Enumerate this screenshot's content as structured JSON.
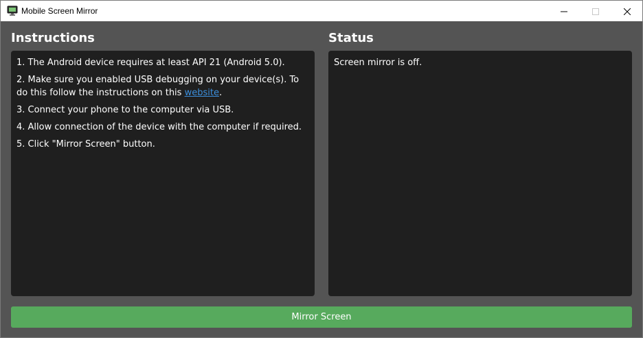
{
  "window": {
    "title": "Mobile Screen Mirror",
    "icon": "monitor-icon",
    "controls": {
      "minimize": "minimize-icon",
      "maximize": "maximize-icon",
      "close": "close-icon"
    }
  },
  "instructions": {
    "heading": "Instructions",
    "items": [
      {
        "text": "1. The Android device requires at least API 21 (Android 5.0)."
      },
      {
        "text_before": "2. Make sure you enabled USB debugging on your device(s). To do this follow the instructions on this ",
        "link_text": "website",
        "text_after": "."
      },
      {
        "text": "3. Connect your phone to the computer via USB."
      },
      {
        "text": "4. Allow connection of the device with the computer if required."
      },
      {
        "text": "5. Click \"Mirror Screen\" button."
      }
    ]
  },
  "status": {
    "heading": "Status",
    "message": "Screen mirror is off."
  },
  "actions": {
    "mirror_label": "Mirror Screen"
  },
  "colors": {
    "background": "#545454",
    "panel": "#1f1f1f",
    "accent_button": "#57aa5d",
    "link": "#3c8fdd"
  }
}
